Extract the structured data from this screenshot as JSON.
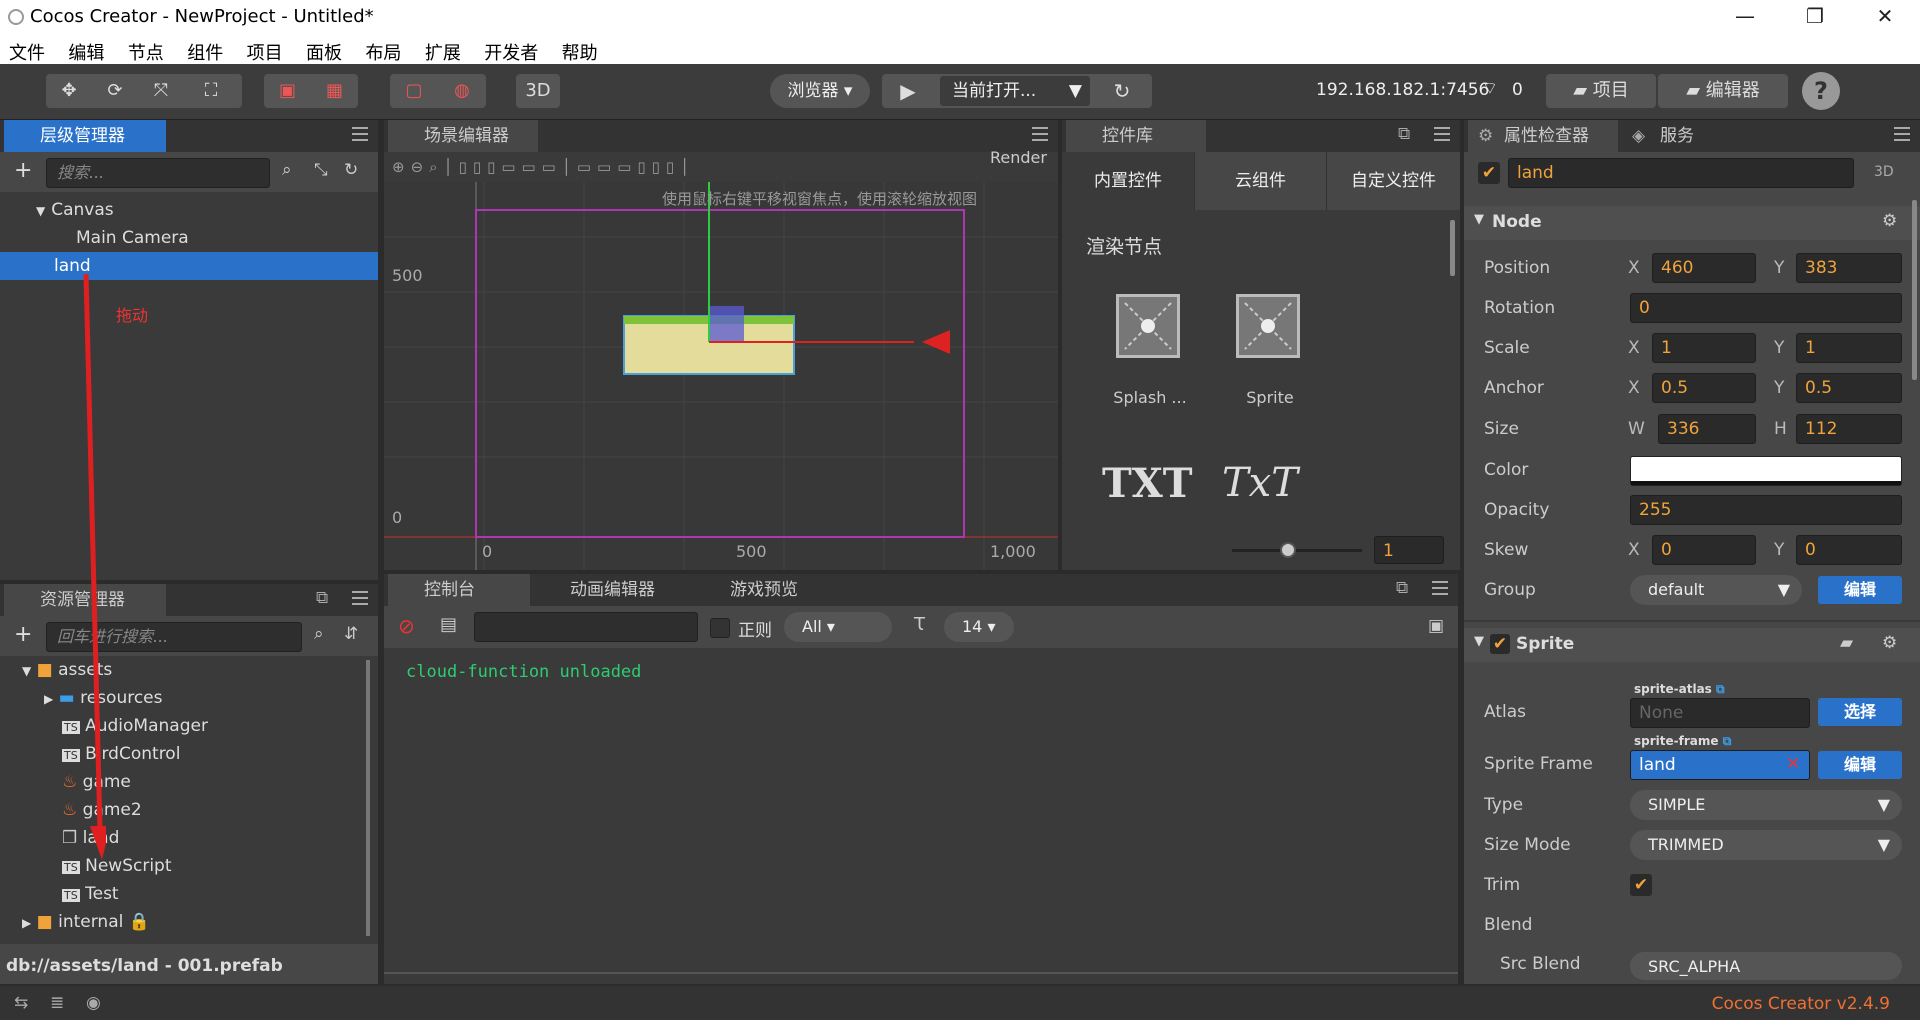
{
  "window": {
    "title": "Cocos Creator - NewProject - Untitled*",
    "minimize": "—",
    "restore": "❐",
    "close": "✕"
  },
  "menu": [
    "文件",
    "编辑",
    "节点",
    "组件",
    "项目",
    "面板",
    "布局",
    "扩展",
    "开发者",
    "帮助"
  ],
  "toolbar": {
    "btn3d": "3D",
    "browser": "浏览器 ▾",
    "scene_select": "当前打开...",
    "ip": "192.168.182.1:7456",
    "conn_count": "0",
    "project_btn": "项目",
    "editor_btn": "编辑器",
    "help": "?"
  },
  "hierarchy": {
    "tab": "层级管理器",
    "search_placeholder": "搜索...",
    "items": [
      "Canvas",
      "Main Camera",
      "land"
    ],
    "annotation": "拖动"
  },
  "scene": {
    "tab": "场景编辑器",
    "hint": "使用鼠标右键平移视窗焦点，使用滚轮缩放视图",
    "render_label": "Render",
    "y_labels": [
      "500",
      "0"
    ],
    "x_labels": [
      "0",
      "500",
      "1,000"
    ]
  },
  "library": {
    "tab": "控件库",
    "tabs": [
      "内置控件",
      "云组件",
      "自定义控件"
    ],
    "section": "渲染节点",
    "items": [
      "Splash ...",
      "Sprite"
    ],
    "txt1": "TXT",
    "txt2": "TxT",
    "zoom_value": "1"
  },
  "assets": {
    "tab": "资源管理器",
    "search_placeholder": "回车进行搜索...",
    "items": [
      "assets",
      "resources",
      "AudioManager",
      "BirdControl",
      "game",
      "game2",
      "land",
      "NewScript",
      "Test",
      "internal"
    ],
    "path": "db://assets/land - 001.prefab"
  },
  "console": {
    "tabs": [
      "控制台",
      "动画编辑器",
      "游戏预览"
    ],
    "regex_label": "正则",
    "filter": "All ▾",
    "font_size": "14 ▾",
    "log": "cloud-function unloaded"
  },
  "inspector": {
    "tabs": [
      "属性检查器",
      "服务"
    ],
    "node_name": "land",
    "mode": "3D",
    "node_section": "Node",
    "position": {
      "label": "Position",
      "x": "460",
      "y": "383"
    },
    "rotation": {
      "label": "Rotation",
      "value": "0"
    },
    "scale": {
      "label": "Scale",
      "x": "1",
      "y": "1"
    },
    "anchor": {
      "label": "Anchor",
      "x": "0.5",
      "y": "0.5"
    },
    "size": {
      "label": "Size",
      "w": "336",
      "h": "112"
    },
    "color": {
      "label": "Color",
      "value": "#ffffff"
    },
    "opacity": {
      "label": "Opacity",
      "value": "255"
    },
    "skew": {
      "label": "Skew",
      "x": "0",
      "y": "0"
    },
    "group": {
      "label": "Group",
      "value": "default",
      "edit": "编辑"
    },
    "sprite_section": "Sprite",
    "atlas": {
      "label": "Atlas",
      "tag": "sprite-atlas",
      "value": "None",
      "btn": "选择"
    },
    "sprite_frame": {
      "label": "Sprite Frame",
      "tag": "sprite-frame",
      "value": "land",
      "btn": "编辑"
    },
    "type": {
      "label": "Type",
      "value": "SIMPLE"
    },
    "size_mode": {
      "label": "Size Mode",
      "value": "TRIMMED"
    },
    "trim": {
      "label": "Trim"
    },
    "blend": {
      "label": "Blend"
    },
    "src_blend": {
      "label": "Src Blend",
      "value": "SRC_ALPHA"
    },
    "xlab": "X",
    "ylab": "Y",
    "wlab": "W",
    "hlab": "H"
  },
  "status": {
    "version": "Cocos Creator v2.4.9"
  }
}
